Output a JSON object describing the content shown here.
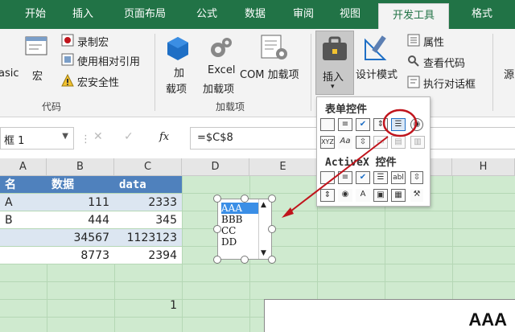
{
  "tabs": [
    "开始",
    "插入",
    "页面布局",
    "公式",
    "数据",
    "审阅",
    "视图",
    "开发工具",
    "格式"
  ],
  "ribbon": {
    "code_group": {
      "basic_label": "asic",
      "macro_label": "宏",
      "record_macro": "录制宏",
      "relative_ref": "使用相对引用",
      "macro_security": "宏安全性",
      "group_label": "代码"
    },
    "addins_group": {
      "addins_label_1": "加",
      "addins_label_2": "载项",
      "excel_addins_1": "Excel",
      "excel_addins_2": "加载项",
      "com_addins": "COM 加载项",
      "group_label": "加载项"
    },
    "controls_group": {
      "insert_label": "插入",
      "design_mode_label": "设计模式",
      "properties": "属性",
      "view_code": "查看代码",
      "run_dialog": "执行对话框",
      "source_partial": "源"
    }
  },
  "dropdown": {
    "form_controls_title": "表单控件",
    "activex_title": "ActiveX 控件",
    "label_aa": "Aa",
    "label_xyz": "XYZ",
    "label_a": "A",
    "label_abl": "abl"
  },
  "formula_bar": {
    "name_box": "框 1",
    "fx": "fx",
    "formula": "=$C$8"
  },
  "columns": [
    "A",
    "B",
    "C",
    "D",
    "E",
    "F",
    "G",
    "H"
  ],
  "sheet": {
    "header_row": [
      "名",
      "数据",
      "data"
    ],
    "rows": [
      [
        "A",
        "111",
        "2333"
      ],
      [
        "B",
        "444",
        "345"
      ],
      [
        "",
        "34567",
        "1123123"
      ],
      [
        "",
        "8773",
        "2394"
      ]
    ],
    "c8_value": "1",
    "chart_text": "AAA"
  },
  "listbox": {
    "items": [
      "AAA",
      "BBB",
      "CC",
      "DD"
    ],
    "selected": "AAA"
  },
  "colors": {
    "tab_bar": "#217346",
    "sheet_fill": "#cfeacf",
    "header_fill": "#4f81bd",
    "highlight_circle": "#c0141c"
  }
}
